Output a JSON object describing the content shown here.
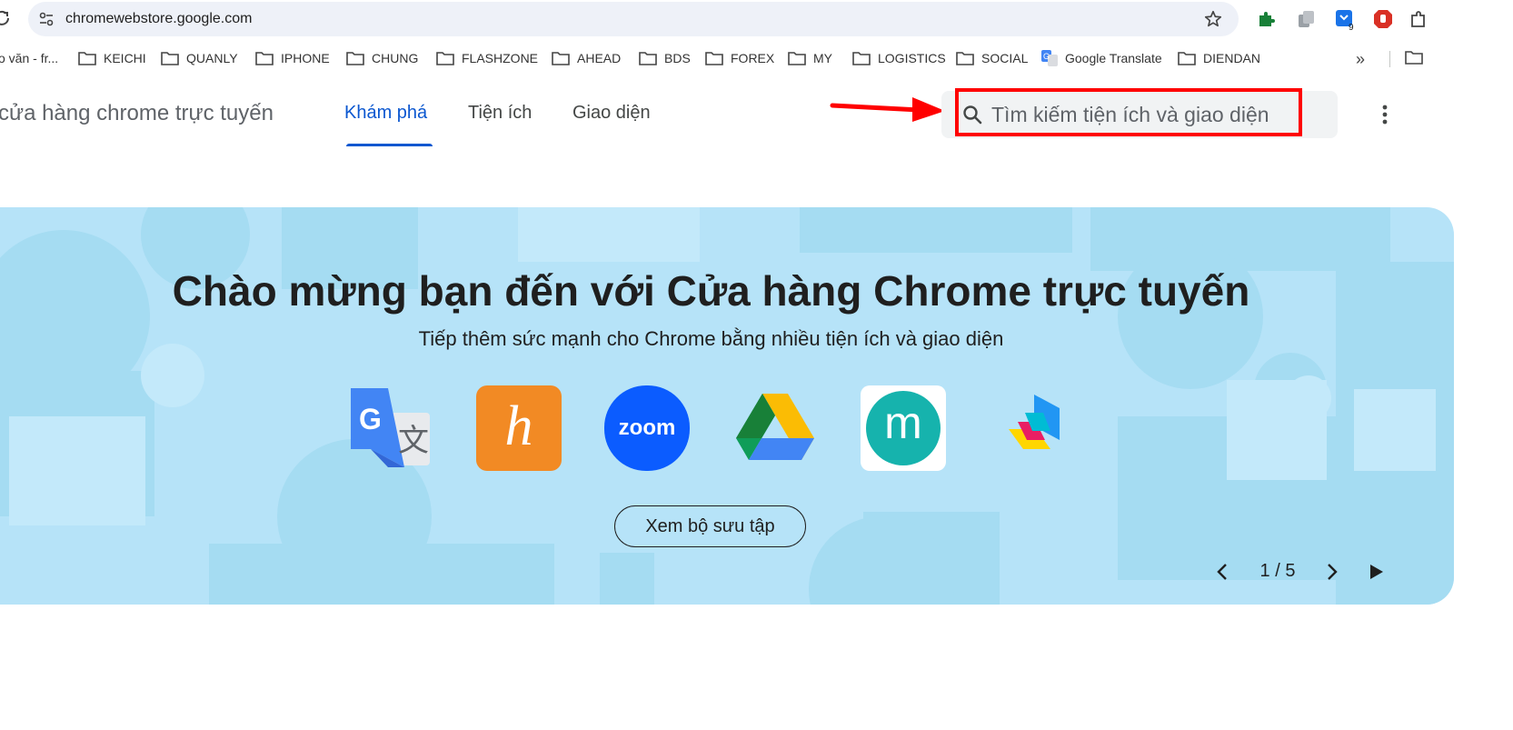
{
  "browser": {
    "url": "chromewebstore.google.com",
    "extensions": [
      {
        "name": "puzzle-extension-icon",
        "color": "#188038"
      },
      {
        "name": "copy-extension-icon",
        "color": "#9aa0a6"
      },
      {
        "name": "download-extension-icon",
        "color": "#1a73e8",
        "badge": "9"
      },
      {
        "name": "stop-hand-extension-icon",
        "color": "#d93025"
      }
    ]
  },
  "bookmarks": {
    "items": [
      {
        "label": "o văn - fr...",
        "icon": "none"
      },
      {
        "label": "KEICHI",
        "icon": "folder-icon"
      },
      {
        "label": "QUANLY",
        "icon": "folder-icon"
      },
      {
        "label": "IPHONE",
        "icon": "folder-icon"
      },
      {
        "label": "CHUNG",
        "icon": "folder-icon"
      },
      {
        "label": "FLASHZONE",
        "icon": "folder-icon"
      },
      {
        "label": "AHEAD",
        "icon": "folder-icon"
      },
      {
        "label": "BDS",
        "icon": "folder-icon"
      },
      {
        "label": "FOREX",
        "icon": "folder-icon"
      },
      {
        "label": "MY",
        "icon": "folder-icon"
      },
      {
        "label": "LOGISTICS",
        "icon": "folder-icon"
      },
      {
        "label": "SOCIAL",
        "icon": "folder-icon"
      },
      {
        "label": "Google Translate",
        "icon": "google-translate-icon"
      },
      {
        "label": "DIENDAN",
        "icon": "folder-icon"
      }
    ],
    "more": "»"
  },
  "store": {
    "title": "cửa hàng chrome trực tuyến",
    "tabs": [
      {
        "label": "Khám phá",
        "active": true
      },
      {
        "label": "Tiện ích",
        "active": false
      },
      {
        "label": "Giao diện",
        "active": false
      }
    ],
    "search_placeholder": "Tìm kiếm tiện ích và giao diện"
  },
  "hero": {
    "title": "Chào mừng bạn đến với Cửa hàng Chrome trực tuyến",
    "subtitle": "Tiếp thêm sức mạnh cho Chrome bằng nhiều tiện ích và giao diện",
    "apps": [
      "google-translate-icon",
      "honey-icon",
      "zoom-icon",
      "google-drive-icon",
      "mote-icon",
      "stack-icon"
    ],
    "zoom_label": "zoom",
    "honey_letter": "h",
    "mote_letter": "m",
    "button_label": "Xem bộ sưu tập",
    "pager": "1 / 5"
  },
  "colors": {
    "accent": "#0b57d0",
    "hero_bg": "#b6e3f8",
    "annotation": "#ff0000"
  }
}
